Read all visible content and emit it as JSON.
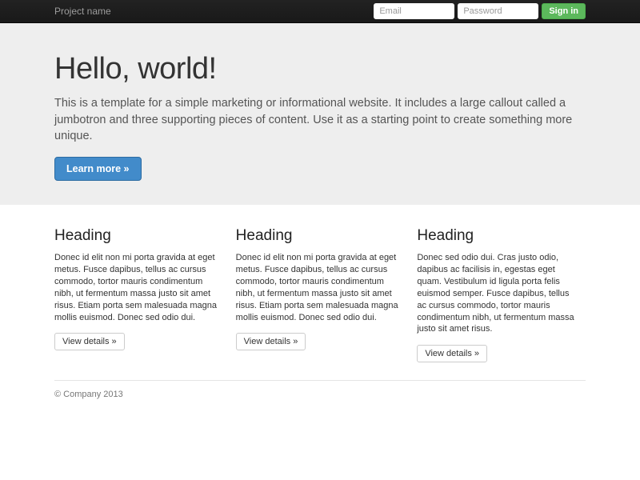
{
  "navbar": {
    "brand": "Project name",
    "email_placeholder": "Email",
    "password_placeholder": "Password",
    "signin_label": "Sign in"
  },
  "jumbotron": {
    "title": "Hello, world!",
    "description": "This is a template for a simple marketing or informational website. It includes a large callout called a jumbotron and three supporting pieces of content. Use it as a starting point to create something more unique.",
    "cta_label": "Learn more »"
  },
  "columns": [
    {
      "heading": "Heading",
      "text": "Donec id elit non mi porta gravida at eget metus. Fusce dapibus, tellus ac cursus commodo, tortor mauris condimentum nibh, ut fermentum massa justo sit amet risus. Etiam porta sem malesuada magna mollis euismod. Donec sed odio dui.",
      "button_label": "View details »"
    },
    {
      "heading": "Heading",
      "text": "Donec id elit non mi porta gravida at eget metus. Fusce dapibus, tellus ac cursus commodo, tortor mauris condimentum nibh, ut fermentum massa justo sit amet risus. Etiam porta sem malesuada magna mollis euismod. Donec sed odio dui.",
      "button_label": "View details »"
    },
    {
      "heading": "Heading",
      "text": "Donec sed odio dui. Cras justo odio, dapibus ac facilisis in, egestas eget quam. Vestibulum id ligula porta felis euismod semper. Fusce dapibus, tellus ac cursus commodo, tortor mauris condimentum nibh, ut fermentum massa justo sit amet risus.",
      "button_label": "View details »"
    }
  ],
  "footer": {
    "copyright": "© Company 2013"
  },
  "colors": {
    "navbar_bg": "#222222",
    "jumbotron_bg": "#eeeeee",
    "primary": "#428bca",
    "success": "#5cb85c"
  }
}
